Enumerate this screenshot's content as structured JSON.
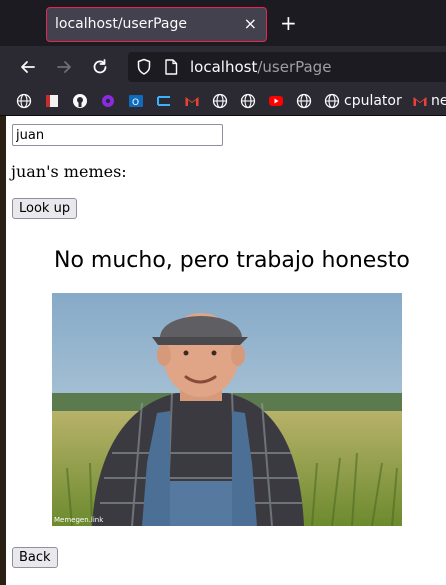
{
  "browser": {
    "tab_title": "localhost/userPage",
    "tab_close": "×",
    "new_tab": "+",
    "url_host": "localhost",
    "url_path": "/userPage",
    "bookmarks_label_1": "cpulator",
    "bookmarks_label_2": "ne"
  },
  "page": {
    "input_value": "juan",
    "memes_heading": "juan's memes:",
    "lookup_label": "Look up",
    "meme_title": "No mucho, pero trabajo honesto",
    "meme_credit": "Memegen.link",
    "back_label": "Back"
  },
  "colors": {
    "tab_border": "#e22850",
    "chrome_dark": "#1c1b22",
    "chrome_bar": "#2b2a33"
  }
}
